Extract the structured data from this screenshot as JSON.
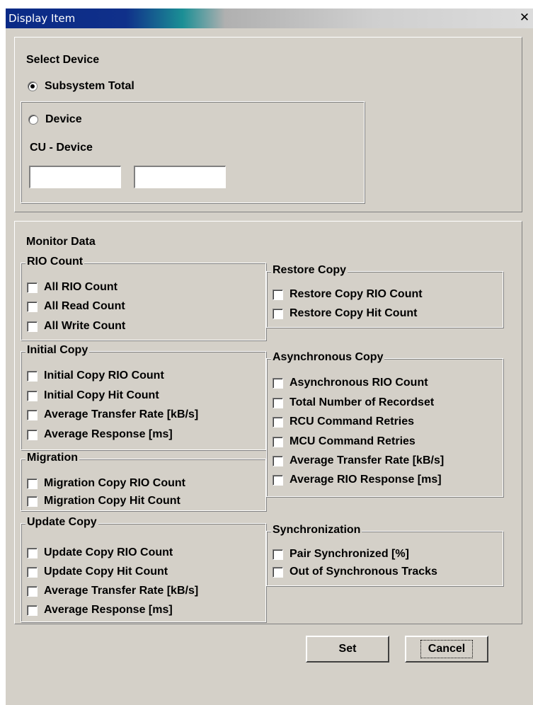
{
  "window": {
    "title": "Display Item",
    "close_glyph": "✕"
  },
  "select_device": {
    "label": "Select Device",
    "subsystem_total": {
      "label": "Subsystem Total",
      "checked": true
    },
    "device": {
      "label": "Device",
      "checked": false
    },
    "cu_device_label": "CU - Device",
    "cu_value": "",
    "device_value": ""
  },
  "monitor_data": {
    "label": "Monitor Data",
    "rio_count": {
      "legend": "RIO Count",
      "items": [
        "All RIO Count",
        "All Read Count",
        "All Write Count"
      ]
    },
    "initial_copy": {
      "legend": "Initial Copy",
      "items": [
        "Initial Copy RIO Count",
        "Initial Copy Hit Count",
        "Average Transfer Rate [kB/s]",
        "Average Response [ms]"
      ]
    },
    "migration": {
      "legend": "Migration",
      "items": [
        "Migration Copy RIO Count",
        "Migration Copy Hit Count"
      ]
    },
    "update_copy": {
      "legend": "Update Copy",
      "items": [
        "Update Copy RIO Count",
        "Update Copy Hit Count",
        "Average Transfer Rate [kB/s]",
        "Average Response [ms]"
      ]
    },
    "restore_copy": {
      "legend": "Restore Copy",
      "items": [
        "Restore Copy RIO Count",
        "Restore Copy Hit Count"
      ]
    },
    "asynchronous_copy": {
      "legend": "Asynchronous Copy",
      "items": [
        "Asynchronous RIO Count",
        "Total Number of Recordset",
        "RCU Command Retries",
        "MCU Command Retries",
        "Average Transfer Rate [kB/s]",
        "Average RIO Response [ms]"
      ]
    },
    "synchronization": {
      "legend": "Synchronization",
      "items": [
        "Pair Synchronized [%]",
        "Out of Synchronous Tracks"
      ]
    }
  },
  "buttons": {
    "set": "Set",
    "cancel": "Cancel"
  }
}
